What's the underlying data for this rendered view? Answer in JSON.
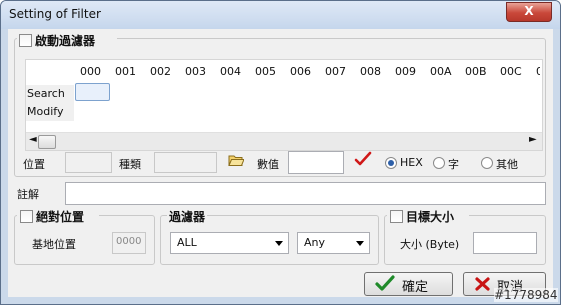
{
  "window": {
    "title": "Setting of Filter",
    "close_label": "X"
  },
  "filter_group": {
    "enable_label": "啟動過濾器",
    "enable_checked": false,
    "columns": [
      "000",
      "001",
      "002",
      "003",
      "004",
      "005",
      "006",
      "007",
      "008",
      "009",
      "00A",
      "00B",
      "00C"
    ],
    "rows": [
      "Search",
      "Modify"
    ]
  },
  "fields": {
    "position_label": "位置",
    "type_label": "種類",
    "value_label": "數值",
    "value": ""
  },
  "radios": {
    "hex_label": "HEX",
    "char_label": "字",
    "other_label": "其他",
    "selected": "hex"
  },
  "comment": {
    "label": "註解",
    "value": ""
  },
  "absolute_group": {
    "label": "絕對位置",
    "checked": false,
    "base_label": "基地位置",
    "base_value": "0000"
  },
  "filter_select_group": {
    "label": "過濾器",
    "first_value": "ALL",
    "second_value": "Any"
  },
  "target_group": {
    "label": "目標大小",
    "checked": false,
    "size_label": "大小 (Byte)",
    "size_value": ""
  },
  "buttons": {
    "ok_label": "確定",
    "cancel_label": "取消"
  },
  "watermark": "#1778984",
  "icons": {
    "folder": "folder-open-icon",
    "check": "red-check-icon",
    "ok": "green-check-icon",
    "cancel": "red-x-icon"
  }
}
